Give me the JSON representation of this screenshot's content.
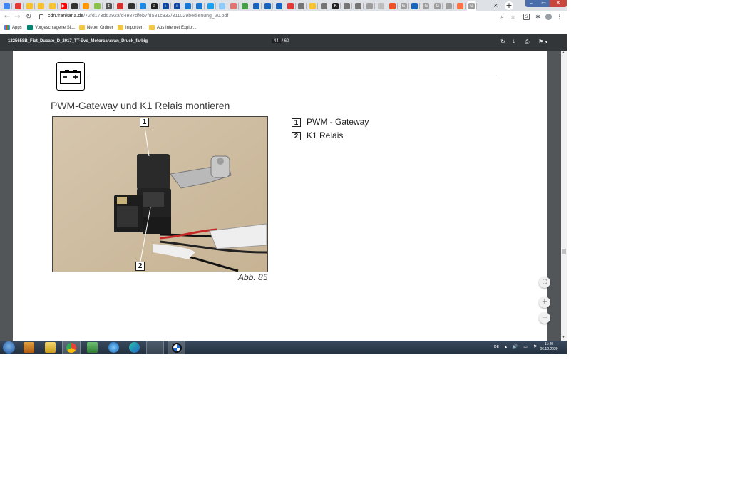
{
  "browser": {
    "tab_favicons": [
      {
        "icon": "chrome-icon",
        "color": "#4285f4",
        "glyph": ""
      },
      {
        "icon": "shopping-icon",
        "color": "#e53935",
        "glyph": ""
      },
      {
        "icon": "bag-icon",
        "color": "#fbc02d",
        "glyph": ""
      },
      {
        "icon": "bag-icon",
        "color": "#fbc02d",
        "glyph": ""
      },
      {
        "icon": "bag-icon",
        "color": "#fbc02d",
        "glyph": ""
      },
      {
        "icon": "youtube-icon",
        "color": "#ff0000",
        "glyph": "▶"
      },
      {
        "icon": "circle-icon",
        "color": "#333333",
        "glyph": ""
      },
      {
        "icon": "fire-icon",
        "color": "#ff9800",
        "glyph": ""
      },
      {
        "icon": "leaf-icon",
        "color": "#8bc34a",
        "glyph": ""
      },
      {
        "icon": "t-icon",
        "color": "#555555",
        "glyph": "t"
      },
      {
        "icon": "media-icon",
        "color": "#d32f2f",
        "glyph": ""
      },
      {
        "icon": "fb-icon",
        "color": "#333333",
        "glyph": ""
      },
      {
        "icon": "globe-icon",
        "color": "#1e88e5",
        "glyph": ""
      },
      {
        "icon": "amazon-icon",
        "color": "#222222",
        "glyph": "a"
      },
      {
        "icon": "info-icon",
        "color": "#0d47a1",
        "glyph": "i"
      },
      {
        "icon": "info-icon",
        "color": "#0d47a1",
        "glyph": "i"
      },
      {
        "icon": "wave-icon",
        "color": "#1976d2",
        "glyph": ""
      },
      {
        "icon": "wave-icon",
        "color": "#1976d2",
        "glyph": ""
      },
      {
        "icon": "twitter-icon",
        "color": "#1da1f2",
        "glyph": ""
      },
      {
        "icon": "cloud-icon",
        "color": "#90caf9",
        "glyph": ""
      },
      {
        "icon": "pen-icon",
        "color": "#e57373",
        "glyph": ""
      },
      {
        "icon": "check-icon",
        "color": "#43a047",
        "glyph": ""
      },
      {
        "icon": "doc-icon",
        "color": "#1565c0",
        "glyph": ""
      },
      {
        "icon": "doc-icon",
        "color": "#1565c0",
        "glyph": ""
      },
      {
        "icon": "doc-icon",
        "color": "#1565c0",
        "glyph": ""
      },
      {
        "icon": "abb-icon",
        "color": "#e53935",
        "glyph": ""
      },
      {
        "icon": "globe-icon",
        "color": "#757575",
        "glyph": ""
      },
      {
        "icon": "minus-icon",
        "color": "#fbc02d",
        "glyph": ""
      },
      {
        "icon": "globe-icon",
        "color": "#757575",
        "glyph": ""
      },
      {
        "icon": "k-icon",
        "color": "#222222",
        "glyph": "K"
      },
      {
        "icon": "globe-icon",
        "color": "#757575",
        "glyph": ""
      },
      {
        "icon": "globe-icon",
        "color": "#757575",
        "glyph": ""
      },
      {
        "icon": "ne-icon",
        "color": "#9e9e9e",
        "glyph": ""
      },
      {
        "icon": "box-icon",
        "color": "#bdbdbd",
        "glyph": ""
      },
      {
        "icon": "windows-icon",
        "color": "#f25022",
        "glyph": ""
      },
      {
        "icon": "google-icon",
        "color": "#9e9e9e",
        "glyph": "G"
      },
      {
        "icon": "doc-icon",
        "color": "#1565c0",
        "glyph": ""
      },
      {
        "icon": "google-icon",
        "color": "#9e9e9e",
        "glyph": "G"
      },
      {
        "icon": "google-icon",
        "color": "#9e9e9e",
        "glyph": "G"
      },
      {
        "icon": "camera-icon",
        "color": "#9e9e9e",
        "glyph": ""
      },
      {
        "icon": "firefox-icon",
        "color": "#ff7043",
        "glyph": ""
      },
      {
        "icon": "google-icon",
        "color": "#9e9e9e",
        "glyph": "G"
      }
    ],
    "tab_label_ne": "Ne",
    "tab_close": "×",
    "new_tab": "+",
    "window_controls": {
      "minimize": "–",
      "restore": "▭",
      "close": "✕"
    },
    "nav": {
      "back": "←",
      "forward": "→",
      "reload": "↻"
    },
    "url_host": "cdn.frankana.de",
    "url_path": "/72/d173d6392afd4e87dfeb7fd581c333/311029bedienung_20.pdf",
    "toolbar_icons": [
      "zoom-icon",
      "star-icon",
      "extension-s-icon",
      "puzzle-icon",
      "avatar-icon",
      "menu-icon"
    ],
    "toolbar_glyphs": {
      "zoom": "⌕",
      "star": "☆",
      "ext": "S",
      "puzzle": "✱",
      "avatar": "●",
      "menu": "⋮"
    },
    "bookmarks": [
      {
        "label": "Apps",
        "icon": "apps-grid-icon"
      },
      {
        "label": "Vorgeschlagene Sit...",
        "icon": "bing-icon"
      },
      {
        "label": "Neuer Ordner",
        "icon": "folder-icon"
      },
      {
        "label": "Importiert",
        "icon": "folder-icon"
      },
      {
        "label": "Aus Internet Explor...",
        "icon": "folder-icon"
      }
    ]
  },
  "pdf_viewer": {
    "filename": "1325658B_Fiat_Ducato_D_2017_TT-Evo_Motorcaravan_Druck_farbig",
    "current_page": "44",
    "page_separator": "/",
    "total_pages": "60",
    "icons": {
      "rotate": "↻",
      "download": "⤓",
      "print": "⎙",
      "bookmark": "⚑",
      "dropdown": "▾"
    },
    "zoom_controls": {
      "fit": "⛶",
      "zoom_in": "+",
      "zoom_out": "−"
    }
  },
  "document": {
    "section_icon": "battery-icon",
    "heading": "PWM-Gateway und K1 Relais montieren",
    "figure_caption": "Abb. 85",
    "callouts": [
      {
        "number": "1",
        "label": "PWM - Gateway"
      },
      {
        "number": "2",
        "label": "K1 Relais"
      }
    ]
  },
  "taskbar": {
    "apps": [
      "start-orb-icon",
      "media-player-icon",
      "file-explorer-icon",
      "chrome-icon",
      "task-manager-icon",
      "internet-explorer-icon",
      "edge-icon",
      "snipping-tool-icon",
      "bmw-icon"
    ],
    "language": "DE",
    "tray_glyphs": "▴ 🔊 ▭ ⚑",
    "time": "11:40",
    "date": "06.12.2020"
  }
}
